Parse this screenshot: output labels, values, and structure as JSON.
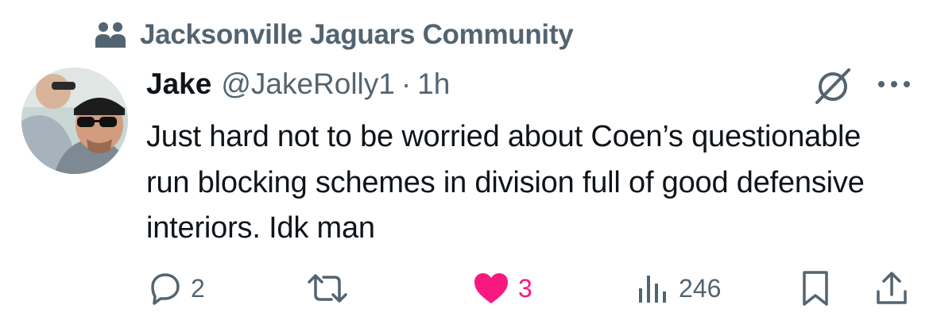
{
  "community": {
    "name": "Jacksonville Jaguars Community",
    "icon": "community-icon"
  },
  "post": {
    "author_name": "Jake",
    "author_handle": "@JakeRolly1",
    "separator": "·",
    "time": "1h",
    "text": "Just hard not to be worried about Coen’s questionable run blocking schemes in division full of good defensive interiors. Idk man"
  },
  "actions": {
    "reply_count": "2",
    "like_count": "3",
    "views_count": "246"
  },
  "colors": {
    "text": "#0f1419",
    "secondary": "#536471",
    "like": "#f91880"
  }
}
